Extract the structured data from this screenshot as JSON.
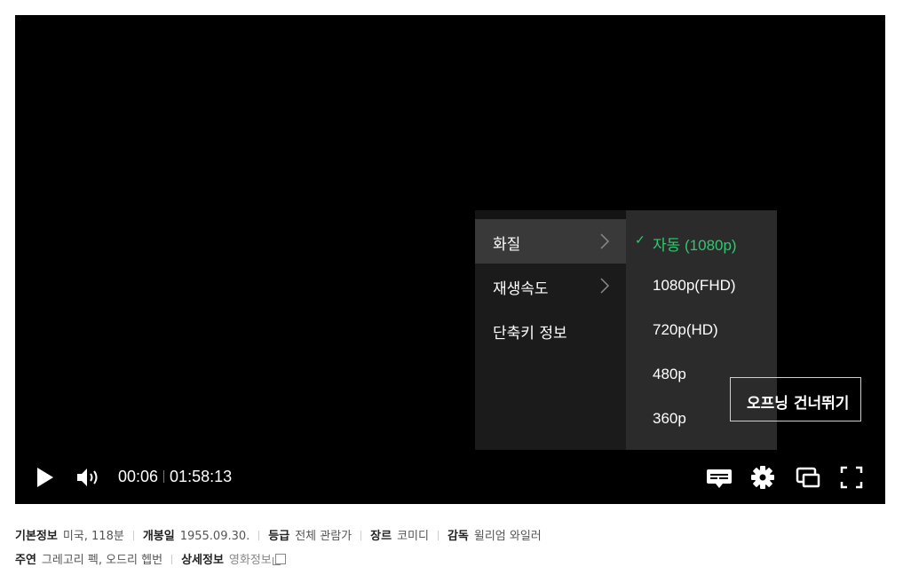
{
  "menu": {
    "items": [
      {
        "label": "화질",
        "has_submenu": true
      },
      {
        "label": "재생속도",
        "has_submenu": true
      },
      {
        "label": "단축키 정보",
        "has_submenu": false
      }
    ]
  },
  "quality": {
    "options": [
      "자동 (1080p)",
      "1080p(FHD)",
      "720p(HD)",
      "480p",
      "360p"
    ],
    "selected_check": "✓"
  },
  "skip_button": {
    "label": "오프닝 건너뛰기"
  },
  "player": {
    "current_time": "00:06",
    "duration": "01:58:13",
    "icons": [
      "play-icon",
      "volume-icon",
      "subtitle-icon",
      "settings-icon",
      "pip-icon",
      "fullscreen-icon"
    ]
  },
  "info": {
    "basic_label": "기본정보",
    "basic_value": "미국, 118분",
    "release_label": "개봉일",
    "release_value": "1955.09.30.",
    "rating_label": "등급",
    "rating_value": "전체 관람가",
    "genre_label": "장르",
    "genre_value": "코미디",
    "director_label": "감독",
    "director_value": "윌리엄 와일러",
    "cast_label": "주연",
    "cast_value": "그레고리 펙, 오드리 헵번",
    "detail_label": "상세정보",
    "detail_value": "영화정보"
  },
  "colors": {
    "accent": "#2fc86e",
    "player_bg": "#000000",
    "menu_bg": "#1b1b1b",
    "submenu_bg": "#2b2b2b"
  }
}
